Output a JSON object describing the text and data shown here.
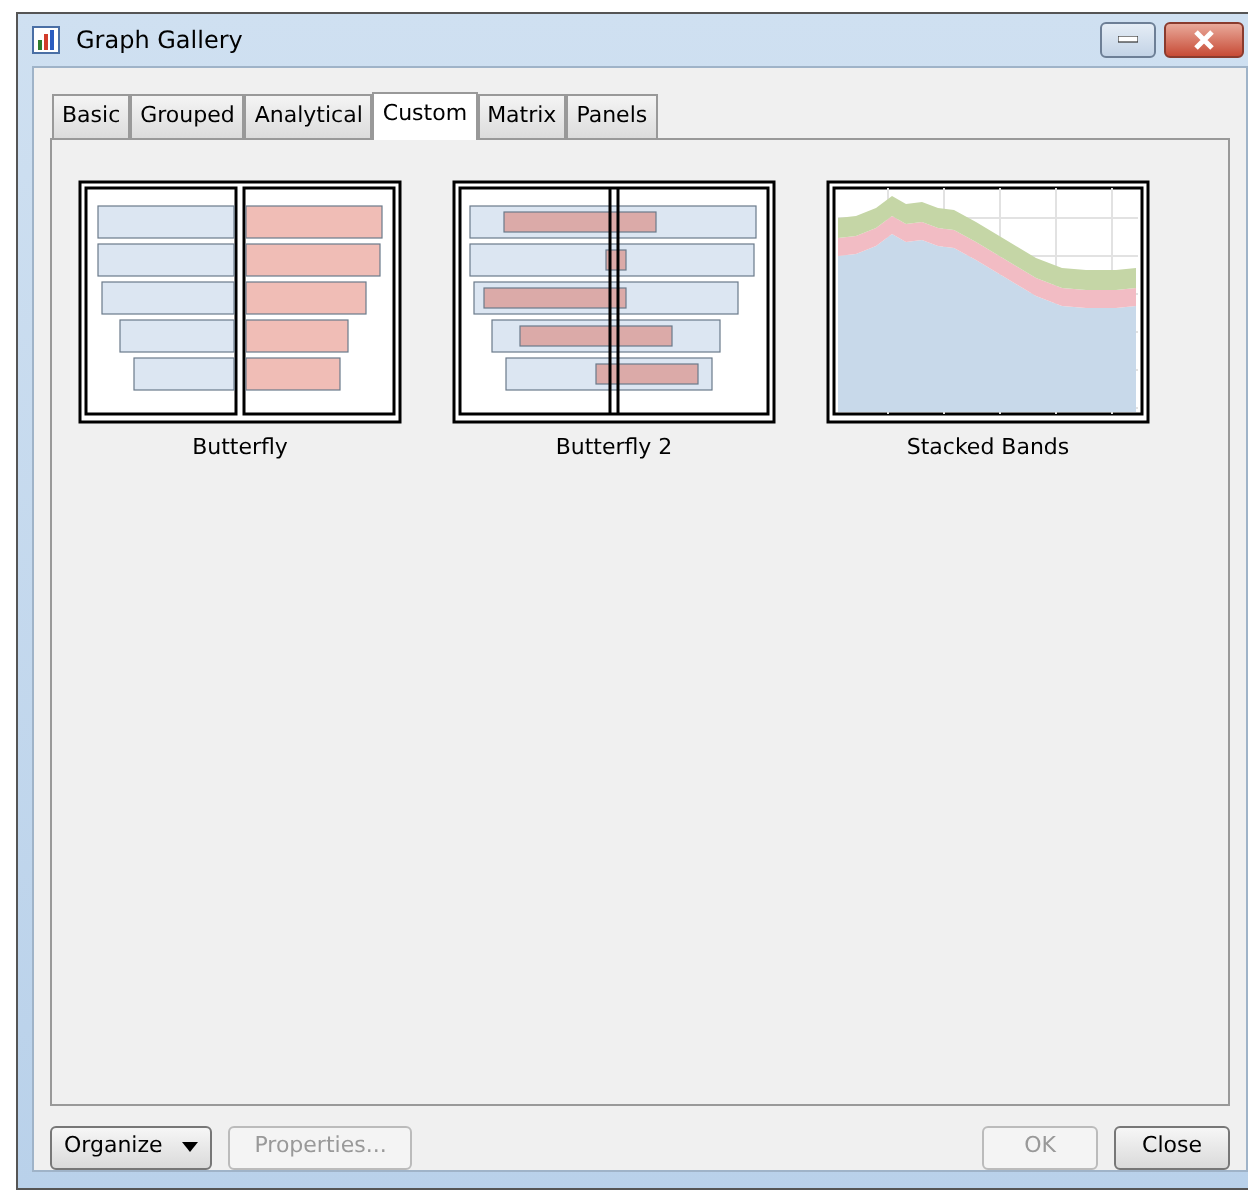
{
  "window": {
    "title": "Graph Gallery"
  },
  "tabs": [
    {
      "label": "Basic",
      "selected": false
    },
    {
      "label": "Grouped",
      "selected": false
    },
    {
      "label": "Analytical",
      "selected": false
    },
    {
      "label": "Custom",
      "selected": true
    },
    {
      "label": "Matrix",
      "selected": false
    },
    {
      "label": "Panels",
      "selected": false
    }
  ],
  "gallery": [
    {
      "label": "Butterfly",
      "kind": "butterfly"
    },
    {
      "label": "Butterfly 2",
      "kind": "butterfly2"
    },
    {
      "label": "Stacked Bands",
      "kind": "bands"
    }
  ],
  "buttons_left": [
    {
      "label": "Organize",
      "kind": "dropdown",
      "disabled": false
    },
    {
      "label": "Properties...",
      "kind": "plain",
      "disabled": true
    }
  ],
  "buttons_right": [
    {
      "label": "OK",
      "disabled": true
    },
    {
      "label": "Close",
      "disabled": false
    }
  ]
}
